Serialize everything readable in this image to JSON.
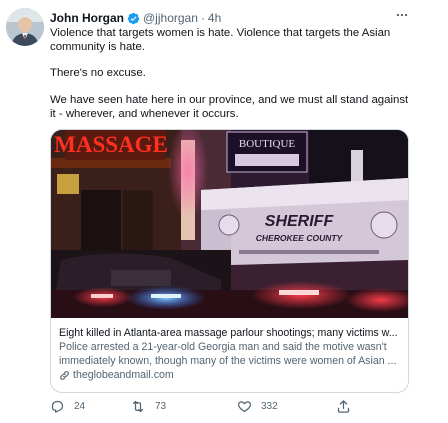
{
  "tweet": {
    "author": {
      "name": "John Horgan",
      "handle": "@jjhorgan",
      "separator": "·",
      "time": "4h",
      "verified": true
    },
    "text": {
      "p1": "Violence that targets women is hate. Violence that targets the Asian community is hate.",
      "p2": "There's no excuse.",
      "p3": "We have seen hate here in our province, and we must all stand against it - wherever, and whenever it occurs."
    },
    "card": {
      "image": {
        "sign_massage": "MASSAGE",
        "sign_boutique": "BOUTIQUE",
        "vehicle_sheriff": "SHERIFF",
        "vehicle_county": "CHEROKEE COUNTY"
      },
      "title": "Eight killed in Atlanta-area massage parlour shootings; many victims w...",
      "description": "Police arrested a 21-year-old Georgia man and said the motive wasn't immediately known, though many of the victims were women of Asian ...",
      "domain": "theglobeandmail.com"
    },
    "actions": {
      "replies": "24",
      "retweets": "73",
      "likes": "332"
    },
    "icons": {
      "verified": "verified-badge-icon",
      "more": "more-icon",
      "link": "link-icon",
      "reply": "reply-icon",
      "retweet": "retweet-icon",
      "like": "heart-icon",
      "share": "share-icon"
    },
    "colors": {
      "text": "#0f1419",
      "secondary": "#536471",
      "verified": "#1d9bf0",
      "border": "#cfd9de"
    }
  }
}
